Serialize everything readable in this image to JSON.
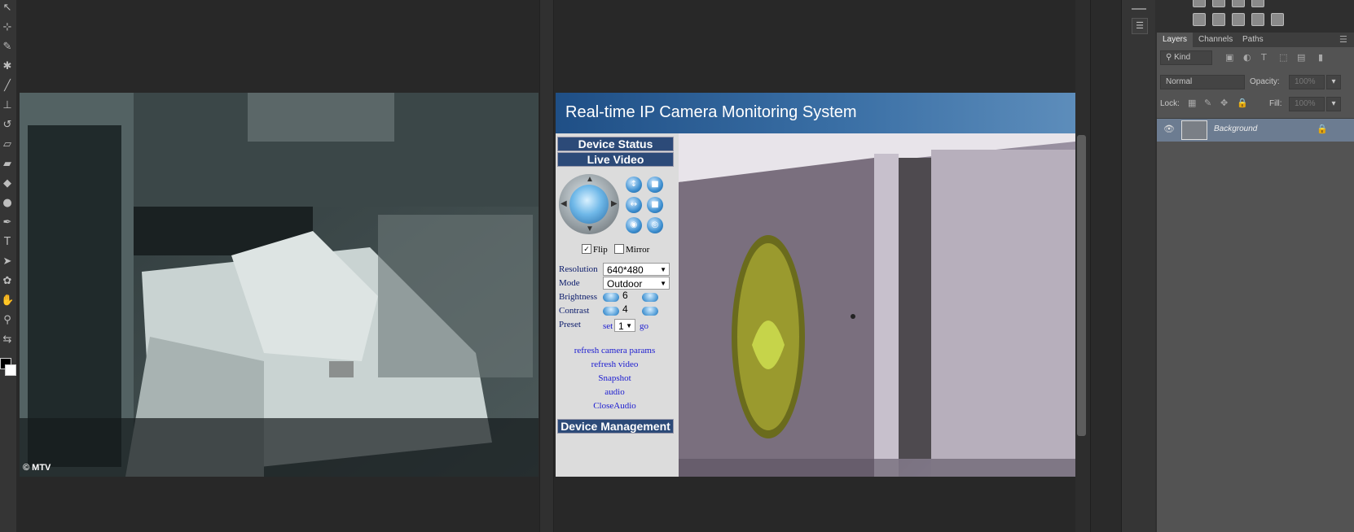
{
  "app": {
    "name": "Photoshop"
  },
  "tools": [
    {
      "name": "move-tool-icon",
      "glyph": "↖"
    },
    {
      "name": "artboard-tool-icon",
      "glyph": "⊹"
    },
    {
      "name": "eyedropper-tool-icon",
      "glyph": "✎"
    },
    {
      "name": "healing-tool-icon",
      "glyph": "✱"
    },
    {
      "name": "brush-tool-icon",
      "glyph": "╱"
    },
    {
      "name": "stamp-tool-icon",
      "glyph": "⊥"
    },
    {
      "name": "history-brush-tool-icon",
      "glyph": "↺"
    },
    {
      "name": "eraser-tool-icon",
      "glyph": "▱"
    },
    {
      "name": "gradient-tool-icon",
      "glyph": "▰"
    },
    {
      "name": "blur-tool-icon",
      "glyph": "◆"
    },
    {
      "name": "dodge-tool-icon",
      "glyph": "●"
    },
    {
      "name": "pen-tool-icon",
      "glyph": "✒"
    },
    {
      "name": "type-tool-icon",
      "glyph": "T"
    },
    {
      "name": "path-selection-tool-icon",
      "glyph": "➤"
    },
    {
      "name": "shape-tool-icon",
      "glyph": "✿"
    },
    {
      "name": "hand-tool-icon",
      "glyph": "✋"
    },
    {
      "name": "zoom-tool-icon",
      "glyph": "⚲"
    },
    {
      "name": "swap-colors-icon",
      "glyph": "⇆"
    }
  ],
  "document1": {
    "watermark": "© MTV"
  },
  "camera": {
    "title": "Real-time IP Camera Monitoring System",
    "device_status": "Device Status",
    "live_video": "Live Video",
    "flip": {
      "label": "Flip",
      "checked": "✓"
    },
    "mirror": {
      "label": "Mirror"
    },
    "resolution": {
      "label": "Resolution",
      "value": "640*480"
    },
    "mode": {
      "label": "Mode",
      "value": "Outdoor"
    },
    "brightness": {
      "label": "Brightness",
      "value": "6"
    },
    "contrast": {
      "label": "Contrast",
      "value": "4"
    },
    "preset": {
      "label": "Preset",
      "set": "set",
      "value": "1",
      "go": "go"
    },
    "links": [
      "refresh camera params",
      "refresh video",
      "Snapshot",
      "audio",
      "CloseAudio"
    ],
    "device_management": "Device Management"
  },
  "layers_panel": {
    "tabs": [
      "Layers",
      "Channels",
      "Paths"
    ],
    "kind_filter": "Kind",
    "blend_mode": "Normal",
    "opacity_label": "Opacity:",
    "opacity_value": "100%",
    "lock_label": "Lock:",
    "fill_label": "Fill:",
    "fill_value": "100%",
    "layers": [
      {
        "name": "Background",
        "locked": true,
        "visible": true
      }
    ]
  }
}
